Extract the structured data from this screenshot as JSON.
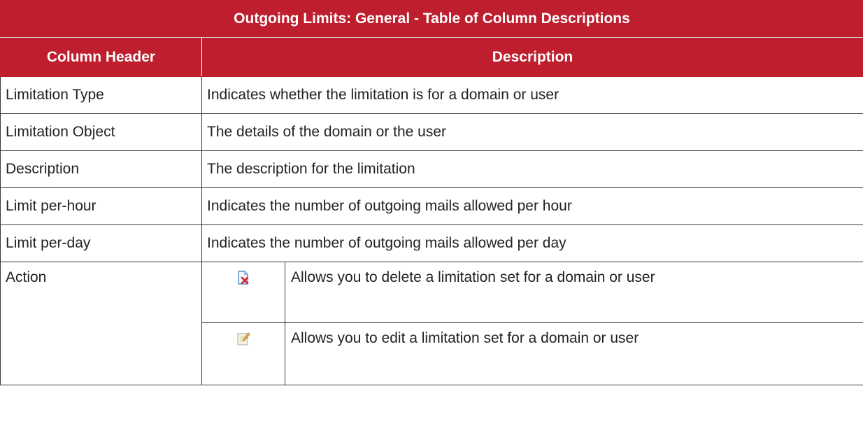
{
  "table": {
    "title": "Outgoing Limits: General - Table of Column Descriptions",
    "headers": {
      "column_header": "Column Header",
      "description": "Description"
    },
    "rows": [
      {
        "name": "Limitation Type",
        "description": "Indicates whether the limitation is for a domain or user"
      },
      {
        "name": "Limitation Object",
        "description": "The details of the domain or the user"
      },
      {
        "name": "Description",
        "description": "The description for the limitation"
      },
      {
        "name": "Limit per-hour",
        "description": "Indicates the number of outgoing mails allowed per hour"
      },
      {
        "name": "Limit per-day",
        "description": "Indicates the number of outgoing mails allowed per day"
      }
    ],
    "action": {
      "name": "Action",
      "items": [
        {
          "icon": "delete-icon",
          "description": "Allows you to delete a limitation set for a domain or user"
        },
        {
          "icon": "edit-icon",
          "description": "Allows you to edit a limitation set for a domain or user"
        }
      ]
    }
  },
  "colors": {
    "header_bg": "#be1e2d",
    "header_text": "#ffffff",
    "border": "#3a3a3a"
  }
}
